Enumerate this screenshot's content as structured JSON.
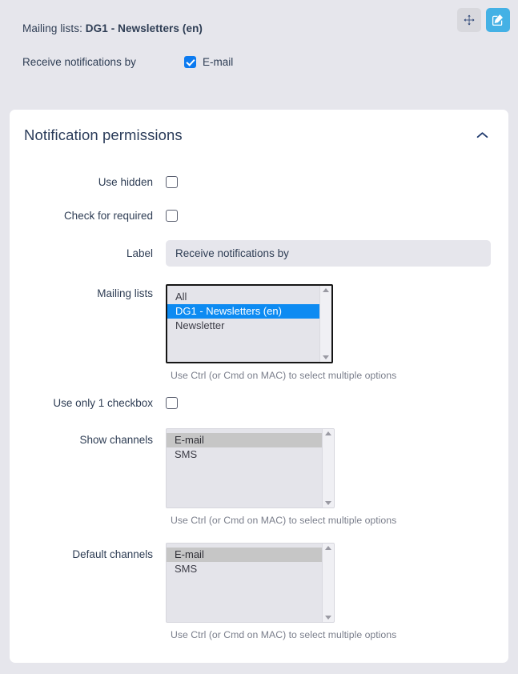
{
  "toolbar": {
    "move_button_title": "Move widget",
    "move_icon": "arrows-move-icon",
    "edit_button_title": "Edit widget",
    "edit_icon": "pencil-square-icon"
  },
  "summary": {
    "mailing_lists_label": "Mailing lists:",
    "mailing_lists_value": "DG1 - Newsletters (en)",
    "receive_label": "Receive notifications by",
    "receive_option_label": "E-mail",
    "receive_option_checked": true
  },
  "card": {
    "title": "Notification permissions",
    "collapse_icon": "chevron-up-icon",
    "collapsed": false
  },
  "fields": {
    "use_hidden": {
      "label": "Use hidden",
      "checked": false
    },
    "check_for_required": {
      "label": "Check for required",
      "checked": false
    },
    "label_field": {
      "label": "Label",
      "value": "Receive notifications by",
      "placeholder": ""
    },
    "mailing_lists": {
      "label": "Mailing lists",
      "focused": true,
      "options": [
        {
          "text": "All",
          "selected": false
        },
        {
          "text": "DG1 - Newsletters (en)",
          "selected": true
        },
        {
          "text": "Newsletter",
          "selected": false
        }
      ],
      "help": "Use Ctrl (or Cmd on MAC) to select multiple options"
    },
    "use_only_1_checkbox": {
      "label": "Use only 1 checkbox",
      "checked": false
    },
    "show_channels": {
      "label": "Show channels",
      "focused": false,
      "options": [
        {
          "text": "E-mail",
          "selected": true
        },
        {
          "text": "SMS",
          "selected": false
        }
      ],
      "help": "Use Ctrl (or Cmd on MAC) to select multiple options"
    },
    "default_channels": {
      "label": "Default channels",
      "focused": false,
      "options": [
        {
          "text": "E-mail",
          "selected": true
        },
        {
          "text": "SMS",
          "selected": false
        }
      ],
      "help": "Use Ctrl (or Cmd on MAC) to select multiple options"
    }
  },
  "colors": {
    "page_background": "#e6e6ec",
    "card_background": "#ffffff",
    "text_primary": "#2e3d54",
    "accent_blue": "#0d7bf0",
    "select_highlight_active": "#0d8bf2",
    "select_highlight_inactive": "#c6c6c6",
    "edit_button": "#44b1e5",
    "move_button": "#d8d8dd",
    "help_text": "#7b7f8c"
  }
}
